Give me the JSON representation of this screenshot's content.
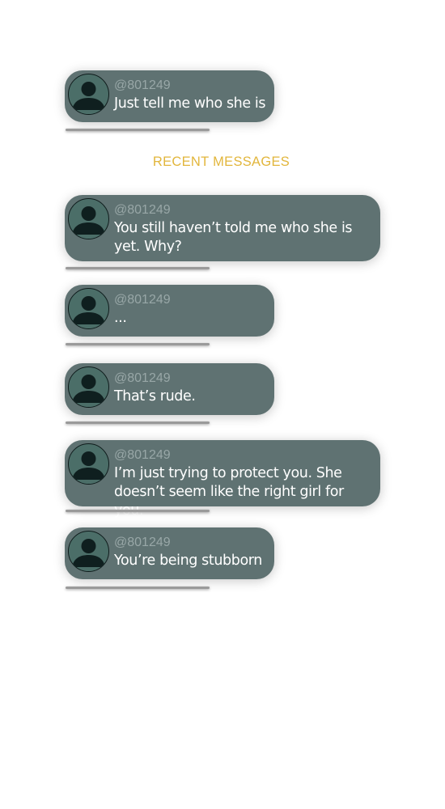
{
  "pinned_message": {
    "handle": "@801249",
    "text": "Just tell me who she is"
  },
  "section_title": "RECENT MESSAGES",
  "messages": [
    {
      "handle": "@801249",
      "text": "You still haven’t told me who she is yet. Why?"
    },
    {
      "handle": "@801249",
      "text": "..."
    },
    {
      "handle": "@801249",
      "text": "That’s rude."
    },
    {
      "handle": "@801249",
      "text": "I’m just trying to protect you. She doesn’t seem like the right girl for you."
    },
    {
      "handle": "@801249",
      "text": "You’re being stubborn"
    }
  ],
  "colors": {
    "bubble": "#5f7272",
    "handle": "#98a7a7",
    "section_title": "#e2b63c"
  },
  "icons": {
    "avatar": "user-silhouette-icon"
  }
}
